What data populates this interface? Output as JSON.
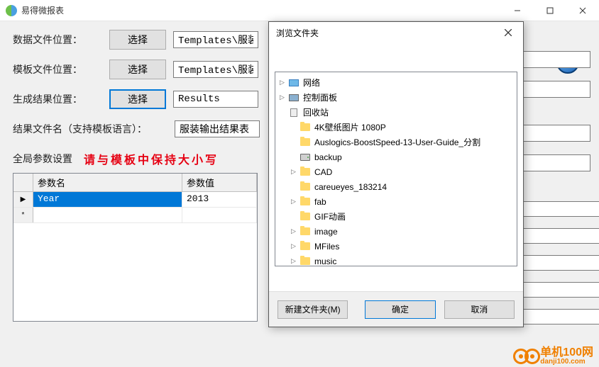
{
  "titlebar": {
    "title": "易得微报表"
  },
  "labels": {
    "data_file_loc": "数据文件位置：",
    "template_file_loc": "模板文件位置：",
    "output_loc": "生成结果位置：",
    "result_filename": "结果文件名（支持模板语言）：",
    "global_params": "全局参数设置",
    "warning": "请与模板中保持大小写"
  },
  "buttons": {
    "choose1": "选择",
    "choose2": "选择",
    "choose3": "选择"
  },
  "values": {
    "data_path": "Templates\\服装",
    "template_path": "Templates\\服装",
    "output_path": "Results",
    "result_filename": "服装输出结果表"
  },
  "param_grid": {
    "headers": {
      "name": "参数名",
      "value": "参数值"
    },
    "rows": [
      {
        "name": "Year",
        "value": "2013"
      }
    ],
    "row_selector_current": "▶",
    "row_selector_new": "*"
  },
  "dialog": {
    "title": "浏览文件夹",
    "tree": [
      {
        "icon": "net",
        "label": "网络",
        "expandable": true,
        "indent": 0
      },
      {
        "icon": "cp",
        "label": "控制面板",
        "expandable": true,
        "indent": 0
      },
      {
        "icon": "bin",
        "label": "回收站",
        "expandable": false,
        "indent": 0
      },
      {
        "icon": "folder",
        "label": "4K壁纸图片 1080P",
        "expandable": false,
        "indent": 1
      },
      {
        "icon": "folder",
        "label": "Auslogics-BoostSpeed-13-User-Guide_分割",
        "expandable": false,
        "indent": 1
      },
      {
        "icon": "drive",
        "label": "backup",
        "expandable": false,
        "indent": 1
      },
      {
        "icon": "folder",
        "label": "CAD",
        "expandable": true,
        "indent": 1
      },
      {
        "icon": "folder",
        "label": "careueyes_183214",
        "expandable": false,
        "indent": 1
      },
      {
        "icon": "folder",
        "label": "fab",
        "expandable": true,
        "indent": 1
      },
      {
        "icon": "folder",
        "label": "GIF动画",
        "expandable": false,
        "indent": 1
      },
      {
        "icon": "folder",
        "label": "image",
        "expandable": true,
        "indent": 1
      },
      {
        "icon": "folder",
        "label": "MFiles",
        "expandable": true,
        "indent": 1
      },
      {
        "icon": "folder",
        "label": "music",
        "expandable": true,
        "indent": 1
      }
    ],
    "buttons": {
      "new_folder": "新建文件夹(M)",
      "ok": "确定",
      "cancel": "取消"
    }
  },
  "watermark": {
    "line1": "单机100网",
    "line2": "danji100.com"
  }
}
